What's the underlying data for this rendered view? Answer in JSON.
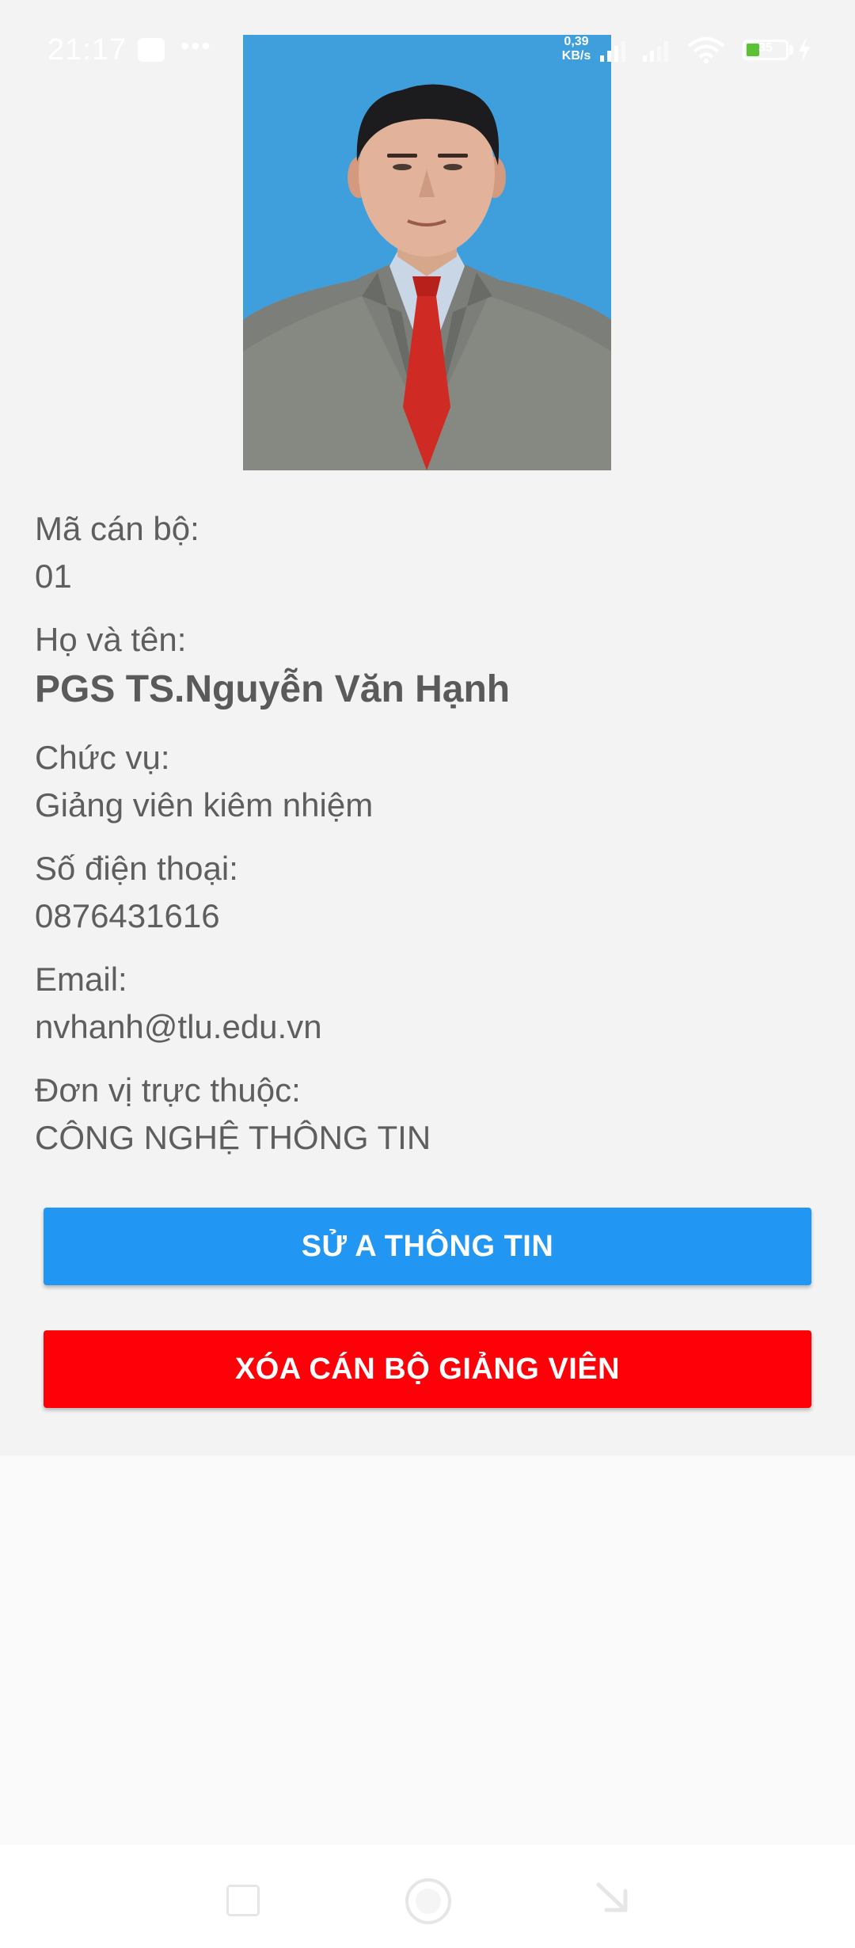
{
  "status_bar": {
    "time": "21:17",
    "dots": "•••",
    "speed_value": "0,39",
    "speed_unit": "KB/s",
    "battery": "35"
  },
  "profile": {
    "staff_id_label": "Mã cán bộ:",
    "staff_id": "01",
    "name_label": "Họ và tên:",
    "name": "PGS TS.Nguyễn Văn Hạnh",
    "position_label": "Chức vụ:",
    "position": "Giảng viên kiêm nhiệm",
    "phone_label": "Số điện thoại:",
    "phone": "0876431616",
    "email_label": "Email:",
    "email": "nvhanh@tlu.edu.vn",
    "unit_label": "Đơn vị trực thuộc:",
    "unit": "CÔNG NGHỆ THÔNG TIN"
  },
  "actions": {
    "edit_label": "SỬ A THÔNG TIN",
    "delete_label": "XÓA CÁN BỘ GIẢNG VIÊN"
  },
  "colors": {
    "edit_button": "#2196f3",
    "delete_button": "#fe0007",
    "photo_background": "#3f9fdd"
  }
}
